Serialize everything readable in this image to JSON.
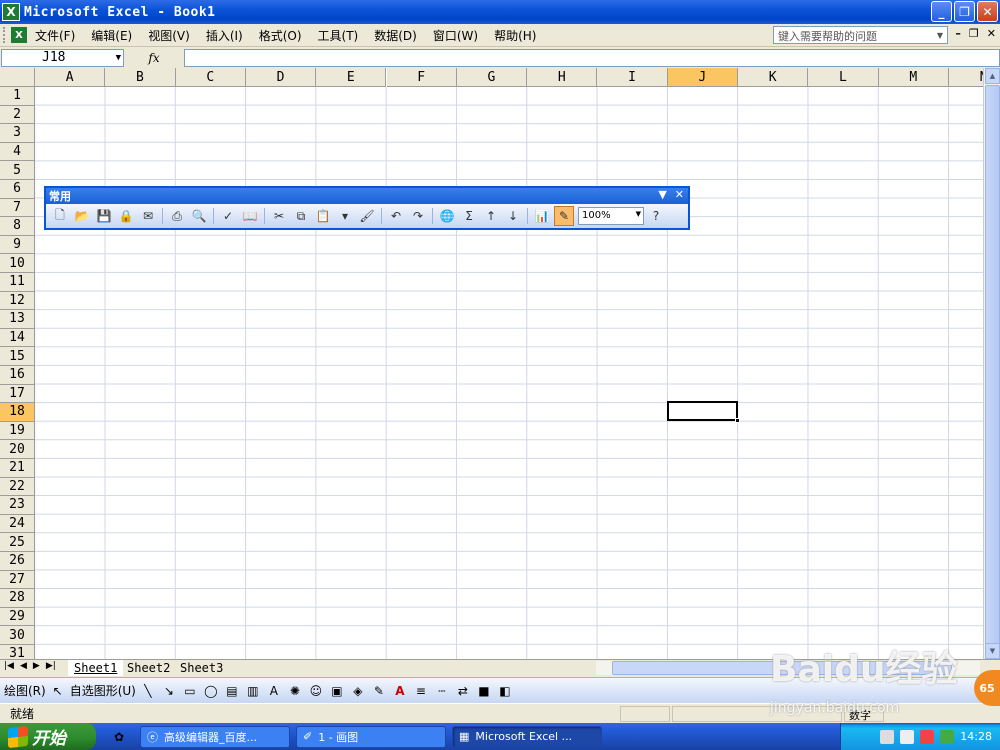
{
  "window": {
    "title": "Microsoft Excel - Book1",
    "icon": "excel-icon",
    "buttons": [
      "minimize-icon",
      "restore-icon",
      "close-icon"
    ]
  },
  "menu": {
    "items": [
      "文件(F)",
      "编辑(E)",
      "视图(V)",
      "插入(I)",
      "格式(O)",
      "工具(T)",
      "数据(D)",
      "窗口(W)",
      "帮助(H)"
    ],
    "help_placeholder": "键入需要帮助的问题"
  },
  "formula_bar": {
    "name_box": "J18",
    "fx": "fx",
    "formula": ""
  },
  "columns": [
    "A",
    "B",
    "C",
    "D",
    "E",
    "F",
    "G",
    "H",
    "I",
    "J",
    "K",
    "L",
    "M",
    "N"
  ],
  "rows": [
    "1",
    "2",
    "3",
    "4",
    "5",
    "6",
    "7",
    "8",
    "9",
    "10",
    "11",
    "12",
    "13",
    "14",
    "15",
    "16",
    "17",
    "18",
    "19",
    "20",
    "21",
    "22",
    "23",
    "24",
    "25",
    "26",
    "27",
    "28",
    "29",
    "30",
    "31"
  ],
  "active_cell": {
    "column": "J",
    "row": "18"
  },
  "standard_toolbar": {
    "title": "常用",
    "zoom": "100%",
    "icons": [
      "new-icon",
      "open-icon",
      "save-icon",
      "permission-icon",
      "print-icon",
      "print-preview-icon",
      "spelling-icon",
      "research-icon",
      "cut-icon",
      "copy-icon",
      "paste-icon",
      "format-painter-icon",
      "undo-icon",
      "redo-icon",
      "hyperlink-icon",
      "autosum-icon",
      "sort-ascending-icon",
      "sort-descending-icon",
      "chart-wizard-icon",
      "drawing-icon",
      "help-icon"
    ]
  },
  "sheets": {
    "tabs": [
      "Sheet1",
      "Sheet2",
      "Sheet3"
    ],
    "active": "Sheet1"
  },
  "drawing_toolbar": {
    "draw_label": "绘图(R)",
    "autoshapes_label": "自选图形(U)"
  },
  "status": {
    "text": "就绪",
    "num": "数字"
  },
  "taskbar": {
    "start": "开始",
    "tasks": [
      {
        "label": "高级编辑器_百度...",
        "icon": "ie-icon",
        "active": false
      },
      {
        "label": "1 - 画图",
        "icon": "paint-icon",
        "active": false
      },
      {
        "label": "Microsoft Excel ...",
        "icon": "excel-icon",
        "active": true
      }
    ],
    "clock": "14:28"
  },
  "watermark": {
    "main": "Baidu经验",
    "sub": "jingyan.baidu.com",
    "badge": "65"
  },
  "colors": {
    "title_blue": "#0A54D8",
    "active_header": "#F9C661",
    "toolbar_bg": "#C1D2EE",
    "taskbar_blue": "#245EDB",
    "start_green": "#2B8A2B"
  }
}
